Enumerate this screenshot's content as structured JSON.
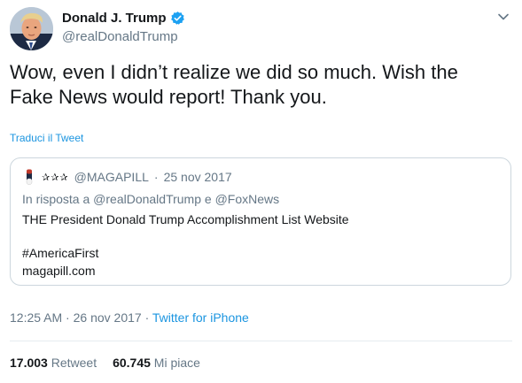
{
  "author": {
    "name": "Donald J. Trump",
    "handle": "@realDonaldTrump"
  },
  "tweet": {
    "text": "Wow, even I didn’t realize we did so much. Wish the\nFake News would report! Thank you.",
    "translate_label": "Traduci il Tweet"
  },
  "quoted": {
    "stars": "✰✰✰",
    "handle": "@MAGAPILL",
    "separator": "·",
    "date": "25 nov 2017",
    "reply_prefix": "In risposta a",
    "reply_user1": "@realDonaldTrump",
    "reply_joiner": "e",
    "reply_user2": "@FoxNews",
    "line1": "THE President Donald Trump Accomplishment List Website",
    "line2": "#AmericaFirst",
    "line3": "magapill.com"
  },
  "meta": {
    "time": "12:25 AM",
    "separator1": "·",
    "date": "26 nov 2017",
    "separator2": "·",
    "source": "Twitter for iPhone"
  },
  "stats": {
    "retweets_count": "17.003",
    "retweets_label": "Retweet",
    "likes_count": "60.745",
    "likes_label": "Mi piace"
  },
  "colors": {
    "link": "#1b95e0",
    "verified": "#1da1f2",
    "secondary_text": "#657786",
    "primary_text": "#14171a",
    "border": "#ccd6dd"
  }
}
